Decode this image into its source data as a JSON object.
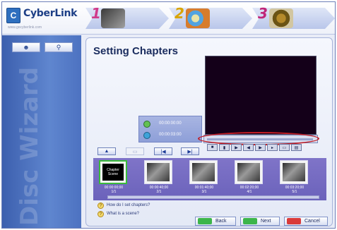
{
  "app": {
    "brand": "CyberLink",
    "brand_url": "www.gocyberlink.com",
    "step_numbers": [
      "1",
      "2",
      "3"
    ]
  },
  "sidebar": {
    "watermark": "Disc Wizard"
  },
  "main": {
    "title": "Setting Chapters",
    "info": {
      "start_time": "00:00:00:00",
      "end_time": "00:00:03:00"
    },
    "player_controls": [
      "■",
      "▮",
      "▶",
      "◀",
      "▶",
      "▸",
      "▭",
      "▤"
    ],
    "nav": [
      "▲",
      "▭",
      "|◀",
      "▶|"
    ],
    "chapters": [
      {
        "time": "00:00:00;00",
        "label": "1/1",
        "title": "Chapter Scene"
      },
      {
        "time": "00:00:40;00",
        "label": "2/1",
        "title": ""
      },
      {
        "time": "00:01:40;00",
        "label": "3/1",
        "title": ""
      },
      {
        "time": "00:02:20;00",
        "label": "4/1",
        "title": ""
      },
      {
        "time": "00:03:20;00",
        "label": "5/1",
        "title": ""
      }
    ],
    "help": [
      "How do I set chapters?",
      "What is a scene?"
    ]
  },
  "footer": {
    "back": "Back",
    "next": "Next",
    "cancel": "Cancel"
  },
  "colors": {
    "accent": "#1d3f86",
    "highlight": "#c11c24",
    "selected": "#3bbb3b"
  }
}
